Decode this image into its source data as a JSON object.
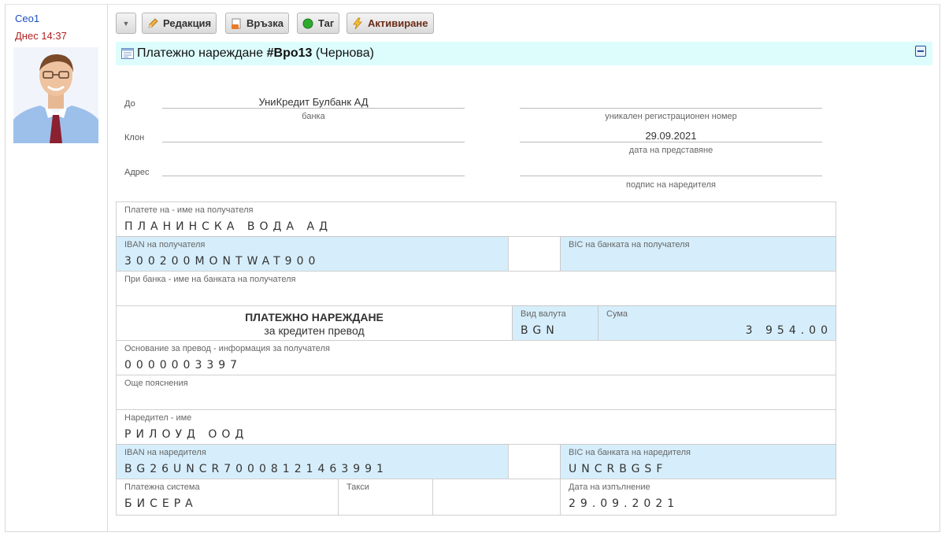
{
  "author": {
    "name": "Ceo1",
    "time": "Днес 14:37"
  },
  "toolbar": {
    "edit_label": "Редакция",
    "link_label": "Връзка",
    "tag_label": "Таг",
    "activate_label": "Активиране"
  },
  "header": {
    "title_prefix": "Платежно нареждане ",
    "doc_id": "#Bpo13",
    "status": " (Чернова)"
  },
  "top_fields": {
    "to_label": "До",
    "bank_value": "УниКредит Булбанк АД",
    "bank_caption": "банка",
    "branch_label": "Клон",
    "address_label": "Адрес",
    "reg_caption": "уникален регистрационен номер",
    "date_value": "29.09.2021",
    "date_caption": "дата на представяне",
    "signature_caption": "подпис на наредителя"
  },
  "form": {
    "payee_name_label": "Платете на - име на получателя",
    "payee_name": "ПЛАНИНСКА ВОДА АД",
    "payee_iban_label": "IBAN на получателя",
    "payee_iban": "300200MONTWAT900",
    "payee_bic_label": "BIC на банката на получателя",
    "payee_bic": "",
    "payee_bank_label": "При банка - име на банката на получателя",
    "payee_bank": "",
    "doc_title": "ПЛАТЕЖНО НАРЕЖДАНЕ",
    "doc_subtitle": "за кредитен превод",
    "currency_label": "Вид валута",
    "currency": "BGN",
    "amount_label": "Сума",
    "amount": "3 954.00",
    "reason_label": "Основание за превод - информация за получателя",
    "reason": "0000003397",
    "notes_label": "Още пояснения",
    "notes": "",
    "payer_name_label": "Наредител - име",
    "payer_name": "РИЛОУД ООД",
    "payer_iban_label": "IBAN на наредителя",
    "payer_iban": "BG26UNCR70008121463991",
    "payer_bic_label": "BIC на банката на наредителя",
    "payer_bic": "UNCRBGSF",
    "system_label": "Платежна система",
    "system": "БИСЕРА",
    "fees_label": "Такси",
    "fees": "",
    "exec_date_label": "Дата на изпълнение",
    "exec_date": "29.09.2021"
  },
  "colors": {
    "title_bar": "#ddfdfd",
    "highlight_row": "#d6eefb",
    "author_link": "#1a4fc4",
    "time": "#b22020"
  }
}
